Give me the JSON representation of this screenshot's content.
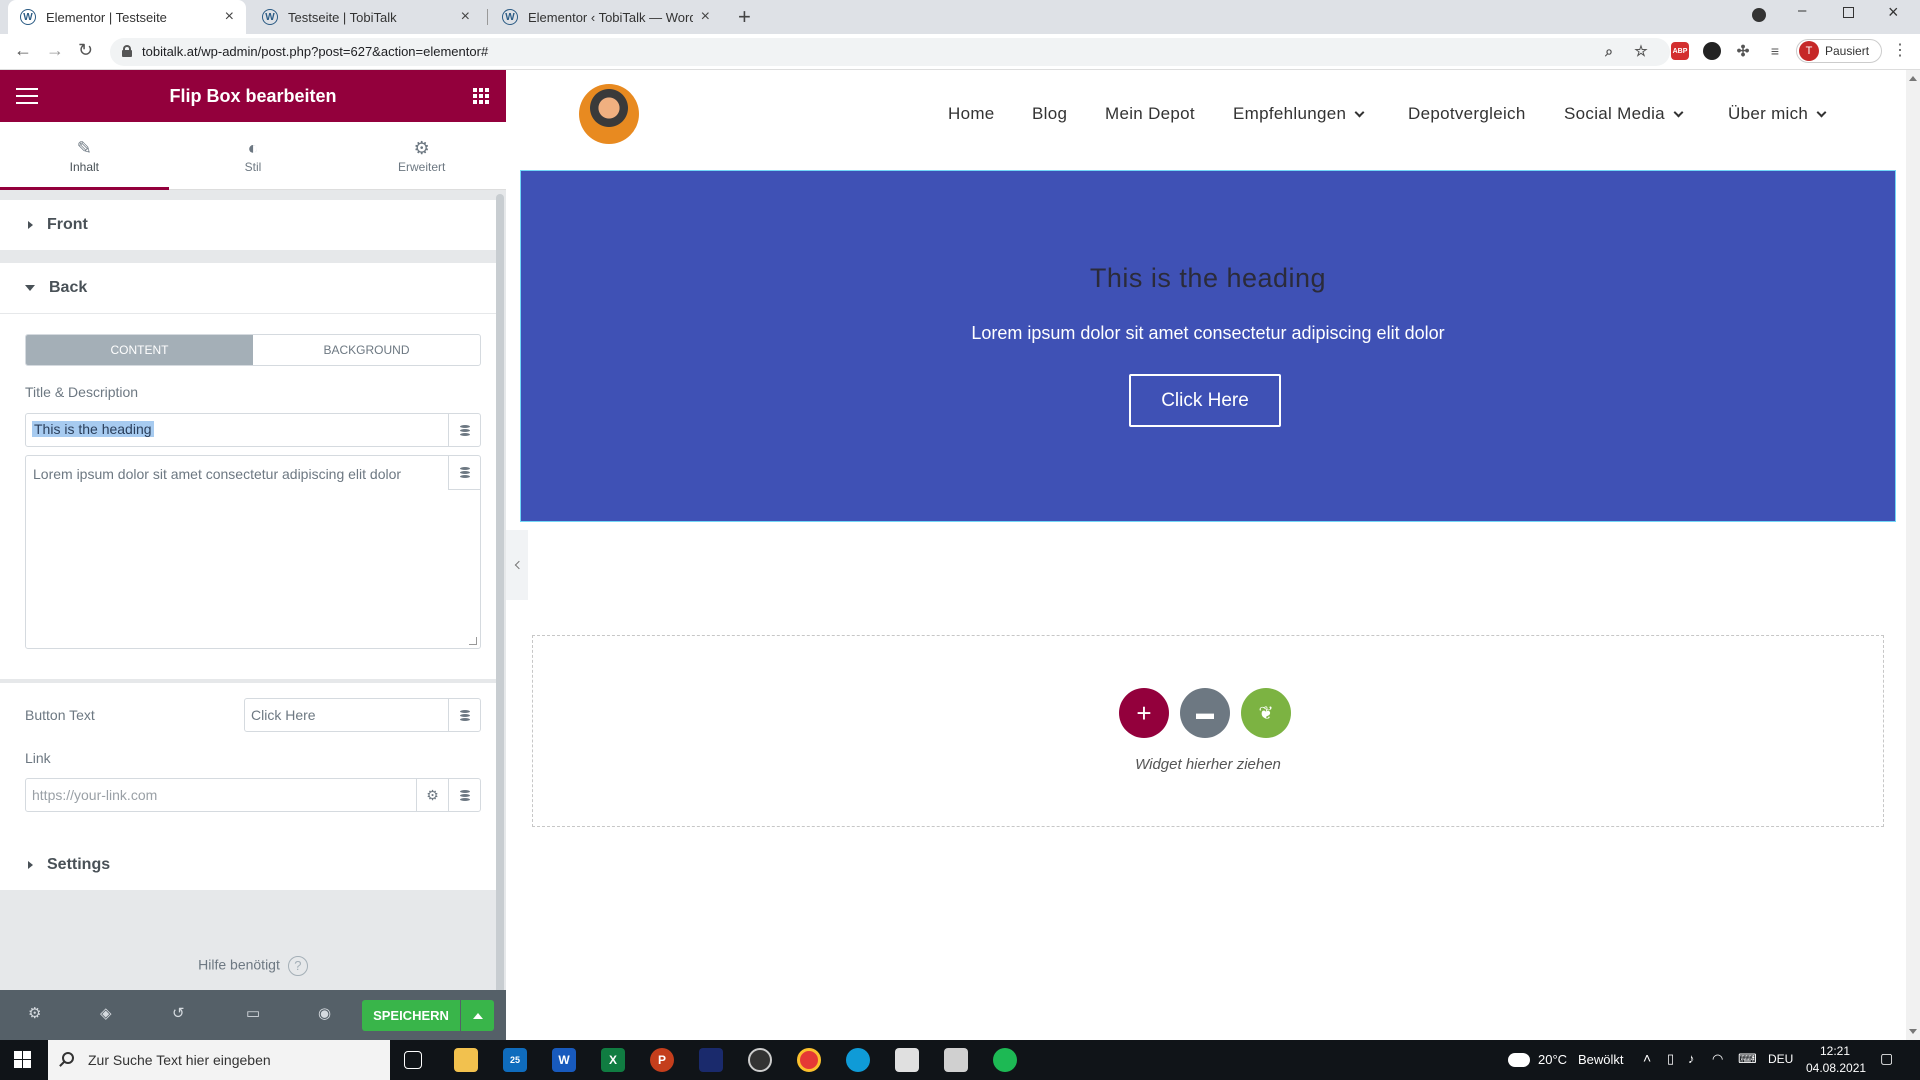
{
  "browser": {
    "tabs": [
      {
        "label": "Elementor | Testseite",
        "active": true
      },
      {
        "label": "Testseite | TobiTalk",
        "active": false
      },
      {
        "label": "Elementor ‹ TobiTalk — WordPre",
        "active": false
      }
    ],
    "url": "tobitalk.at/wp-admin/post.php?post=627&action=elementor#",
    "profile_label": "Pausiert",
    "profile_initial": "T",
    "ext_abp": "ABP"
  },
  "panel": {
    "title": "Flip Box bearbeiten",
    "tabs": [
      {
        "label": "Inhalt",
        "icon": "pencil-icon"
      },
      {
        "label": "Stil",
        "icon": "half-circle-icon"
      },
      {
        "label": "Erweitert",
        "icon": "gear-icon"
      }
    ],
    "sections": {
      "front": "Front",
      "back": "Back",
      "settings": "Settings"
    },
    "back": {
      "toggle_content": "CONTENT",
      "toggle_background": "BACKGROUND",
      "title_desc_label": "Title & Description",
      "title_value": "This is the heading",
      "description_value": "Lorem ipsum dolor sit amet consectetur adipiscing elit dolor",
      "button_text_label": "Button Text",
      "button_text_value": "Click Here",
      "link_label": "Link",
      "link_placeholder": "https://your-link.com"
    },
    "help": "Hilfe benötigt",
    "help_q": "?",
    "save_label": "SPEICHERN"
  },
  "site": {
    "nav": [
      {
        "label": "Home",
        "dropdown": false
      },
      {
        "label": "Blog",
        "dropdown": false
      },
      {
        "label": "Mein Depot",
        "dropdown": false
      },
      {
        "label": "Empfehlungen",
        "dropdown": true
      },
      {
        "label": "Depotvergleich",
        "dropdown": false
      },
      {
        "label": "Social Media",
        "dropdown": true
      },
      {
        "label": "Über mich",
        "dropdown": true
      }
    ],
    "flipbox": {
      "heading": "This is the heading",
      "description": "Lorem ipsum dolor sit amet consectetur adipiscing elit dolor",
      "button": "Click Here",
      "bg_color": "#3f51b5"
    },
    "dropzone_text": "Widget hierher ziehen"
  },
  "taskbar": {
    "search_placeholder": "Zur Suche Text hier eingeben",
    "mail_badge": "25",
    "weather": "20°C",
    "weather_desc": "Bewölkt",
    "lang": "DEU",
    "time": "12:21",
    "date": "04.08.2021"
  },
  "colors": {
    "elementor_brand": "#93003c",
    "save_green": "#39b54a",
    "panel_footer": "#556068"
  }
}
